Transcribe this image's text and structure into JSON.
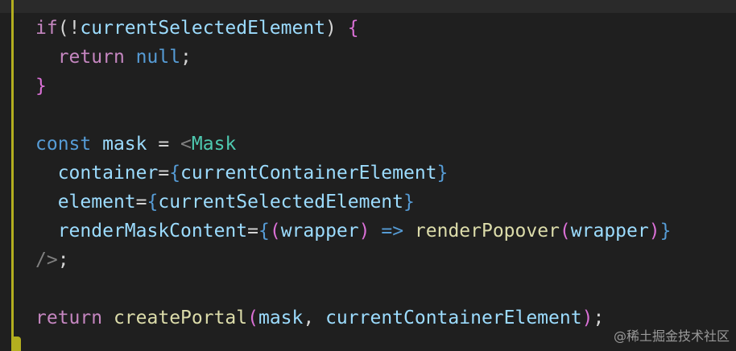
{
  "colors": {
    "keyword": "#c586c0",
    "keyword_blue": "#569cd6",
    "variable": "#9cdcfe",
    "function": "#dcdcaa",
    "component": "#4ec9b0",
    "bracket_pink": "#da70d6",
    "bracket_blue": "#179fff",
    "plain": "#d4d4d4",
    "tag_punct": "#808080",
    "gutter_accent": "#b3ae1f"
  },
  "code_lines": [
    [
      {
        "t": "if",
        "c": "keyword"
      },
      {
        "t": "(!",
        "c": "plain"
      },
      {
        "t": "currentSelectedElement",
        "c": "variable"
      },
      {
        "t": ") ",
        "c": "plain"
      },
      {
        "t": "{",
        "c": "bracket_pink"
      }
    ],
    [
      {
        "t": "  ",
        "c": "plain"
      },
      {
        "t": "return",
        "c": "keyword"
      },
      {
        "t": " ",
        "c": "plain"
      },
      {
        "t": "null",
        "c": "keyword_blue"
      },
      {
        "t": ";",
        "c": "plain"
      }
    ],
    [
      {
        "t": "}",
        "c": "bracket_pink"
      }
    ],
    [],
    [
      {
        "t": "const",
        "c": "keyword_blue"
      },
      {
        "t": " ",
        "c": "plain"
      },
      {
        "t": "mask",
        "c": "variable"
      },
      {
        "t": " = ",
        "c": "plain"
      },
      {
        "t": "<",
        "c": "tag_punct"
      },
      {
        "t": "Mask",
        "c": "component"
      }
    ],
    [
      {
        "t": "  ",
        "c": "plain"
      },
      {
        "t": "container",
        "c": "variable"
      },
      {
        "t": "=",
        "c": "plain"
      },
      {
        "t": "{",
        "c": "keyword_blue"
      },
      {
        "t": "currentContainerElement",
        "c": "variable"
      },
      {
        "t": "}",
        "c": "keyword_blue"
      }
    ],
    [
      {
        "t": "  ",
        "c": "plain"
      },
      {
        "t": "element",
        "c": "variable"
      },
      {
        "t": "=",
        "c": "plain"
      },
      {
        "t": "{",
        "c": "keyword_blue"
      },
      {
        "t": "currentSelectedElement",
        "c": "variable"
      },
      {
        "t": "}",
        "c": "keyword_blue"
      }
    ],
    [
      {
        "t": "  ",
        "c": "plain"
      },
      {
        "t": "renderMaskContent",
        "c": "variable"
      },
      {
        "t": "=",
        "c": "plain"
      },
      {
        "t": "{",
        "c": "keyword_blue"
      },
      {
        "t": "(",
        "c": "bracket_pink"
      },
      {
        "t": "wrapper",
        "c": "variable"
      },
      {
        "t": ")",
        "c": "bracket_pink"
      },
      {
        "t": " ",
        "c": "plain"
      },
      {
        "t": "=>",
        "c": "keyword_blue"
      },
      {
        "t": " ",
        "c": "plain"
      },
      {
        "t": "renderPopover",
        "c": "function"
      },
      {
        "t": "(",
        "c": "bracket_pink"
      },
      {
        "t": "wrapper",
        "c": "variable"
      },
      {
        "t": ")",
        "c": "bracket_pink"
      },
      {
        "t": "}",
        "c": "keyword_blue"
      }
    ],
    [
      {
        "t": "/>",
        "c": "tag_punct"
      },
      {
        "t": ";",
        "c": "plain"
      }
    ],
    [],
    [
      {
        "t": "return",
        "c": "keyword"
      },
      {
        "t": " ",
        "c": "plain"
      },
      {
        "t": "createPortal",
        "c": "function"
      },
      {
        "t": "(",
        "c": "bracket_pink"
      },
      {
        "t": "mask",
        "c": "variable"
      },
      {
        "t": ", ",
        "c": "plain"
      },
      {
        "t": "currentContainerElement",
        "c": "variable"
      },
      {
        "t": ")",
        "c": "bracket_pink"
      },
      {
        "t": ";",
        "c": "plain"
      }
    ]
  ],
  "watermark": "@稀土掘金技术社区"
}
